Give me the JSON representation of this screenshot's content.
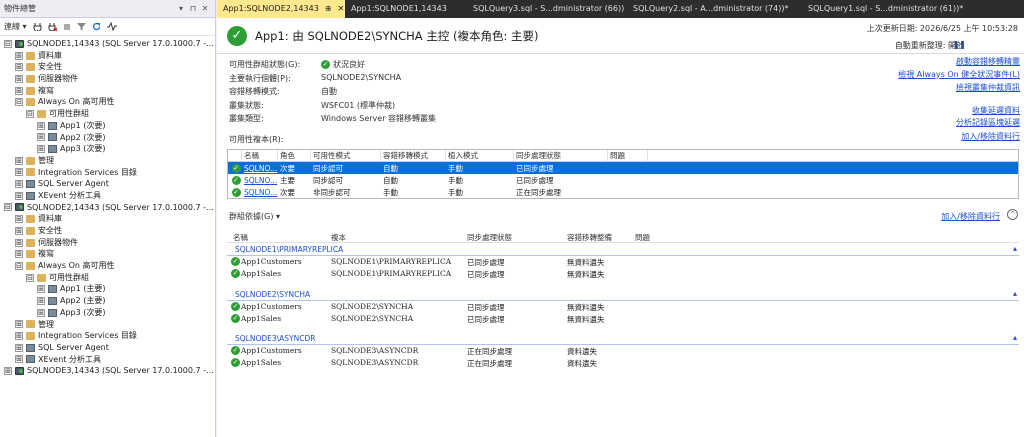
{
  "object_explorer": {
    "title": "物件總管",
    "title_controls": [
      "▾",
      "⊓",
      "✕"
    ],
    "toolbar": {
      "connect_label": "連線 ▾",
      "icons": [
        "plug-icon",
        "unplug-icon",
        "stop-icon",
        "filter-icon",
        "refresh-icon",
        "activity-icon"
      ]
    },
    "tree": [
      {
        "level": 0,
        "exp": "⊟",
        "icon": "server",
        "label": "SQLNODE1,14343 (SQL Server 17.0.1000.7 - W"
      },
      {
        "level": 1,
        "exp": "⊞",
        "icon": "folder",
        "label": "資料庫"
      },
      {
        "level": 1,
        "exp": "⊞",
        "icon": "folder",
        "label": "安全性"
      },
      {
        "level": 1,
        "exp": "⊞",
        "icon": "folder",
        "label": "伺服器物件"
      },
      {
        "level": 1,
        "exp": "⊞",
        "icon": "folder",
        "label": "複寫"
      },
      {
        "level": 1,
        "exp": "⊟",
        "icon": "folder",
        "label": "Always On 高可用性"
      },
      {
        "level": 2,
        "exp": "⊟",
        "icon": "folder",
        "label": "可用性群組"
      },
      {
        "level": 3,
        "exp": "⊞",
        "icon": "grp",
        "label": "App1 (次要)"
      },
      {
        "level": 3,
        "exp": "⊞",
        "icon": "grp",
        "label": "App2 (次要)"
      },
      {
        "level": 3,
        "exp": "⊞",
        "icon": "grp",
        "label": "App3 (次要)"
      },
      {
        "level": 1,
        "exp": "⊞",
        "icon": "folder",
        "label": "管理"
      },
      {
        "level": 1,
        "exp": "⊞",
        "icon": "folder",
        "label": "Integration Services 目錄"
      },
      {
        "level": 1,
        "exp": "⊞",
        "icon": "grp",
        "label": "SQL Server Agent"
      },
      {
        "level": 1,
        "exp": "⊞",
        "icon": "grp",
        "label": "XEvent 分析工具"
      },
      {
        "level": 0,
        "exp": "⊟",
        "icon": "server",
        "label": "SQLNODE2,14343 (SQL Server 17.0.1000.7 - W"
      },
      {
        "level": 1,
        "exp": "⊞",
        "icon": "folder",
        "label": "資料庫"
      },
      {
        "level": 1,
        "exp": "⊞",
        "icon": "folder",
        "label": "安全性"
      },
      {
        "level": 1,
        "exp": "⊞",
        "icon": "folder",
        "label": "伺服器物件"
      },
      {
        "level": 1,
        "exp": "⊞",
        "icon": "folder",
        "label": "複寫"
      },
      {
        "level": 1,
        "exp": "⊟",
        "icon": "folder",
        "label": "Always On 高可用性"
      },
      {
        "level": 2,
        "exp": "⊟",
        "icon": "folder",
        "label": "可用性群組"
      },
      {
        "level": 3,
        "exp": "⊞",
        "icon": "grp",
        "label": "App1 (主要)"
      },
      {
        "level": 3,
        "exp": "⊞",
        "icon": "grp",
        "label": "App2 (主要)"
      },
      {
        "level": 3,
        "exp": "⊞",
        "icon": "grp",
        "label": "App3 (次要)"
      },
      {
        "level": 1,
        "exp": "⊞",
        "icon": "folder",
        "label": "管理"
      },
      {
        "level": 1,
        "exp": "⊞",
        "icon": "folder",
        "label": "Integration Services 目錄"
      },
      {
        "level": 1,
        "exp": "⊞",
        "icon": "grp",
        "label": "SQL Server Agent"
      },
      {
        "level": 1,
        "exp": "⊞",
        "icon": "grp",
        "label": "XEvent 分析工具"
      },
      {
        "level": 0,
        "exp": "⊞",
        "icon": "server",
        "label": "SQLNODE3,14343 (SQL Server 17.0.1000.7 - W"
      }
    ]
  },
  "tabs": [
    {
      "label": "App1:SQLNODE2,14343",
      "pin": "⊕",
      "close": "✕",
      "active": true
    },
    {
      "label": "App1:SQLNODE1,14343",
      "active": false
    },
    {
      "label": "SQLQuery3.sql - S...dministrator (66))",
      "active": false
    },
    {
      "label": "SQLQuery2.sql - A...dministrator (74))*",
      "active": false
    },
    {
      "label": "SQLQuery1.sql - S...dministrator (61))*",
      "active": false
    }
  ],
  "dashboard": {
    "title": "App1: 由 SQLNODE2\\SYNCHA 主控 (複本角色: 主要)",
    "last_update": "上次更新日期: 2026/6/25 上午 10:53:28",
    "auto_refresh": "自動重新整理: 開啟",
    "pause": "❚❚",
    "info": [
      {
        "label": "可用性群組狀態(G):",
        "value": "狀況良好",
        "ok": true
      },
      {
        "label": "主要執行個體(P):",
        "value": "SQLNODE2\\SYNCHA"
      },
      {
        "label": "容錯移轉模式:",
        "value": "自動"
      },
      {
        "label": "叢集狀態:",
        "value": "WSFC01 (標準仲裁)"
      },
      {
        "label": "叢集類型:",
        "value": "Windows Server 容錯移轉叢集"
      }
    ],
    "links_top": [
      "啟動容錯移轉精靈",
      "檢視 Always On 健全狀況事件(L)",
      "檢視叢集仲裁資訊"
    ],
    "links_mid": [
      "收集延遲資料",
      "分析記錄區塊延遲"
    ],
    "replicas_label": "可用性複本(R):",
    "replicas_link": "加入/移除資料行",
    "replica_headers": [
      "名稱",
      "角色",
      "可用性模式",
      "容錯移轉模式",
      "植入模式",
      "同步處理狀態",
      "問題"
    ],
    "replicas": [
      {
        "name": "SQLNO...",
        "role": "次要",
        "mode": "同步認可",
        "failover": "自動",
        "seed": "手動",
        "sync": "已同步處理",
        "issue": "",
        "selected": true
      },
      {
        "name": "SQLNO...",
        "role": "主要",
        "mode": "同步認可",
        "failover": "自動",
        "seed": "手動",
        "sync": "已同步處理",
        "issue": "",
        "selected": false
      },
      {
        "name": "SQLNO...",
        "role": "次要",
        "mode": "非同步認可",
        "failover": "手動",
        "seed": "手動",
        "sync": "正在同步處理",
        "issue": "",
        "selected": false
      }
    ],
    "group_by_label": "群組依據(G) ▾",
    "group_link": "加入/移除資料行",
    "group_collapse": "⌃",
    "db_headers": [
      "名稱",
      "複本",
      "同步處理狀態",
      "容錯移轉整備",
      "問題"
    ],
    "sections": [
      {
        "title": "SQLNODE1\\PRIMARYREPLICA",
        "caret": "▴",
        "rows": [
          {
            "name": "App1Customers",
            "replica": "SQLNODE1\\PRIMARYREPLICA",
            "sync": "已同步處理",
            "ready": "無資料遺失"
          },
          {
            "name": "App1Sales",
            "replica": "SQLNODE1\\PRIMARYREPLICA",
            "sync": "已同步處理",
            "ready": "無資料遺失"
          }
        ]
      },
      {
        "title": "SQLNODE2\\SYNCHA",
        "caret": "▴",
        "rows": [
          {
            "name": "App1Customers",
            "replica": "SQLNODE2\\SYNCHA",
            "sync": "已同步處理",
            "ready": "無資料遺失"
          },
          {
            "name": "App1Sales",
            "replica": "SQLNODE2\\SYNCHA",
            "sync": "已同步處理",
            "ready": "無資料遺失"
          }
        ]
      },
      {
        "title": "SQLNODE3\\ASYNCDR",
        "caret": "▴",
        "rows": [
          {
            "name": "App1Customers",
            "replica": "SQLNODE3\\ASYNCDR",
            "sync": "正在同步處理",
            "ready": "資料遺失"
          },
          {
            "name": "App1Sales",
            "replica": "SQLNODE3\\ASYNCDR",
            "sync": "正在同步處理",
            "ready": "資料遺失"
          }
        ]
      }
    ],
    "check_glyph": "✓"
  }
}
